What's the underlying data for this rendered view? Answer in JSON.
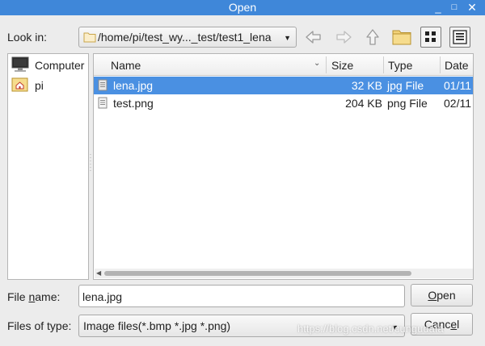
{
  "window": {
    "title": "Open",
    "minimize_glyph": "_",
    "maximize_glyph": "□",
    "close_glyph": "✕"
  },
  "lookin": {
    "label": "Look in:",
    "path": "/home/pi/test_wy..._test/test1_lena",
    "icon": "folder-icon"
  },
  "toolbar": {
    "icons": [
      "back-arrow-icon",
      "forward-arrow-icon",
      "up-arrow-icon",
      "new-folder-icon",
      "detail-view-icon",
      "list-view-icon"
    ]
  },
  "sidebar": {
    "items": [
      {
        "label": "Computer",
        "icon": "computer-icon"
      },
      {
        "label": "pi",
        "icon": "home-folder-icon"
      }
    ]
  },
  "filelist": {
    "columns": [
      "Name",
      "Size",
      "Type",
      "Date"
    ],
    "rows": [
      {
        "name": "lena.jpg",
        "size": "32 KB",
        "type": "jpg File",
        "date": "01/11",
        "selected": true
      },
      {
        "name": "test.png",
        "size": "204 KB",
        "type": "png File",
        "date": "02/11",
        "selected": false
      }
    ]
  },
  "filename": {
    "label_prefix": "File ",
    "label_underlined": "n",
    "label_suffix": "ame:",
    "value": "lena.jpg"
  },
  "filetype": {
    "label": "Files of type:",
    "value": "Image files(*.bmp *.jpg *.png)"
  },
  "buttons": {
    "open_underlined": "O",
    "open_rest": "pen",
    "cancel_prefix": "Canc",
    "cancel_underlined": "e",
    "cancel_suffix": "l"
  },
  "watermark": "https://blog.csdn.net/cungudafa",
  "colors": {
    "titlebar": "#3f87d9",
    "selection": "#4a90e2"
  }
}
